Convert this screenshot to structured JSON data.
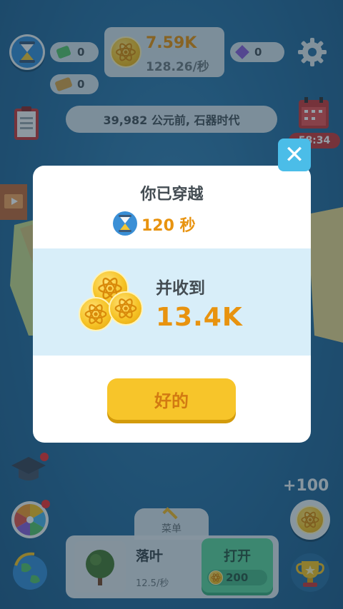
{
  "topbar": {
    "green_currency": "0",
    "ad_ticket": "0",
    "main_currency": "7.59K",
    "rate": "128.26/秒",
    "gem_currency": "0"
  },
  "era_banner": "39,982 公元前, 石器时代",
  "calendar_timer": "58:34",
  "modal": {
    "title": "你已穿越",
    "time": "120 秒",
    "received_label": "并收到",
    "amount": "13.4K",
    "ok_label": "好的"
  },
  "bonus": "+100",
  "menu_label": "菜单",
  "item": {
    "name": "落叶",
    "rate": "12.5/秒",
    "open_label": "打开",
    "cost": "200"
  },
  "colors": {
    "accent_orange": "#e8930f",
    "button_yellow": "#f7c52a",
    "close_blue": "#4bbde8",
    "open_green": "#5fd39c"
  }
}
